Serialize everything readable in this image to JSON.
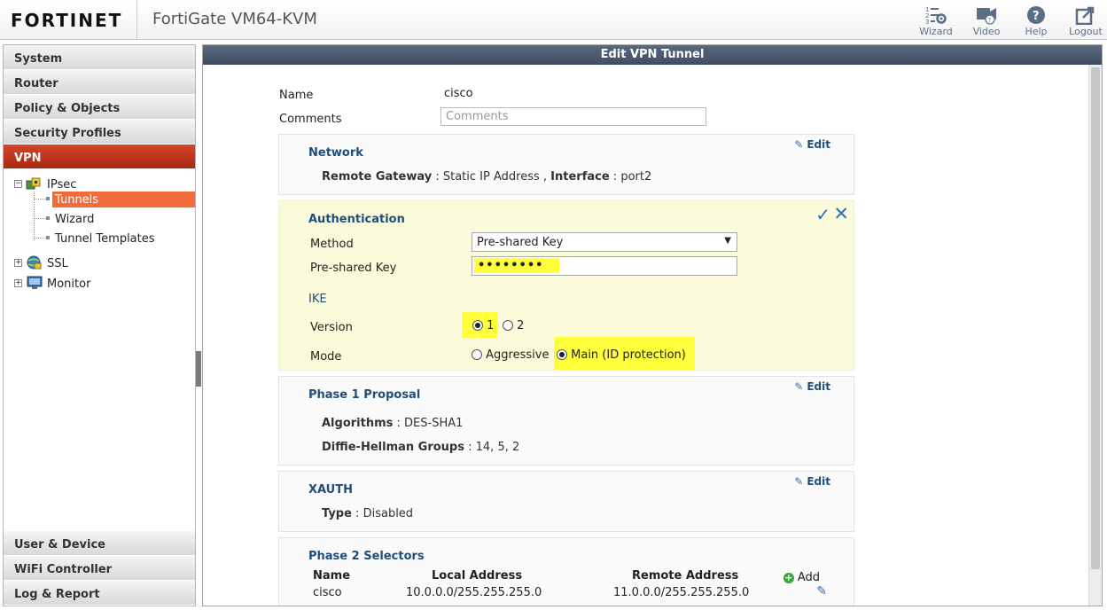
{
  "header": {
    "logo_text": "FORTINET",
    "device_title": "FortiGate VM64-KVM",
    "buttons": {
      "wizard": "Wizard",
      "video": "Video",
      "help": "Help",
      "logout": "Logout"
    }
  },
  "sidebar": {
    "sections_top": [
      "System",
      "Router",
      "Policy & Objects",
      "Security Profiles",
      "VPN"
    ],
    "active_section": "VPN",
    "tree": {
      "ipsec": "IPsec",
      "tunnels": "Tunnels",
      "wizard": "Wizard",
      "tunnel_templates": "Tunnel Templates",
      "ssl": "SSL",
      "monitor": "Monitor"
    },
    "sections_bottom": [
      "User & Device",
      "WiFi Controller",
      "Log & Report"
    ]
  },
  "main": {
    "title": "Edit VPN Tunnel",
    "name_label": "Name",
    "name_value": "cisco",
    "comments_label": "Comments",
    "comments_placeholder": "Comments",
    "edit_label": "Edit",
    "network": {
      "title": "Network",
      "remote_gateway_label": "Remote Gateway",
      "remote_gateway_value": "Static IP Address",
      "interface_label": "Interface",
      "interface_value": "port2"
    },
    "authentication": {
      "title": "Authentication",
      "method_label": "Method",
      "method_value": "Pre-shared Key",
      "psk_label": "Pre-shared Key",
      "psk_value": "••••••••",
      "ike_title": "IKE",
      "version_label": "Version",
      "version_options": [
        "1",
        "2"
      ],
      "version_selected": "1",
      "mode_label": "Mode",
      "mode_aggressive": "Aggressive",
      "mode_main": "Main (ID protection)",
      "mode_selected": "Main (ID protection)"
    },
    "phase1": {
      "title": "Phase 1 Proposal",
      "algorithms_label": "Algorithms",
      "algorithms_value": "DES-SHA1",
      "dh_label": "Diffie-Hellman Groups",
      "dh_value": "14, 5, 2"
    },
    "xauth": {
      "title": "XAUTH",
      "type_label": "Type",
      "type_value": "Disabled"
    },
    "phase2": {
      "title": "Phase 2 Selectors",
      "add_label": "Add",
      "columns": [
        "Name",
        "Local Address",
        "Remote Address"
      ],
      "rows": [
        {
          "name": "cisco",
          "local": "10.0.0.0/255.255.255.0",
          "remote": "11.0.0.0/255.255.255.0"
        }
      ]
    }
  },
  "colors": {
    "active_nav": "#b8321c",
    "selected_tree": "#f36a3b",
    "title_bar": "#4a596d",
    "highlight": "#ffff3c",
    "section_heading": "#1f4e79"
  }
}
